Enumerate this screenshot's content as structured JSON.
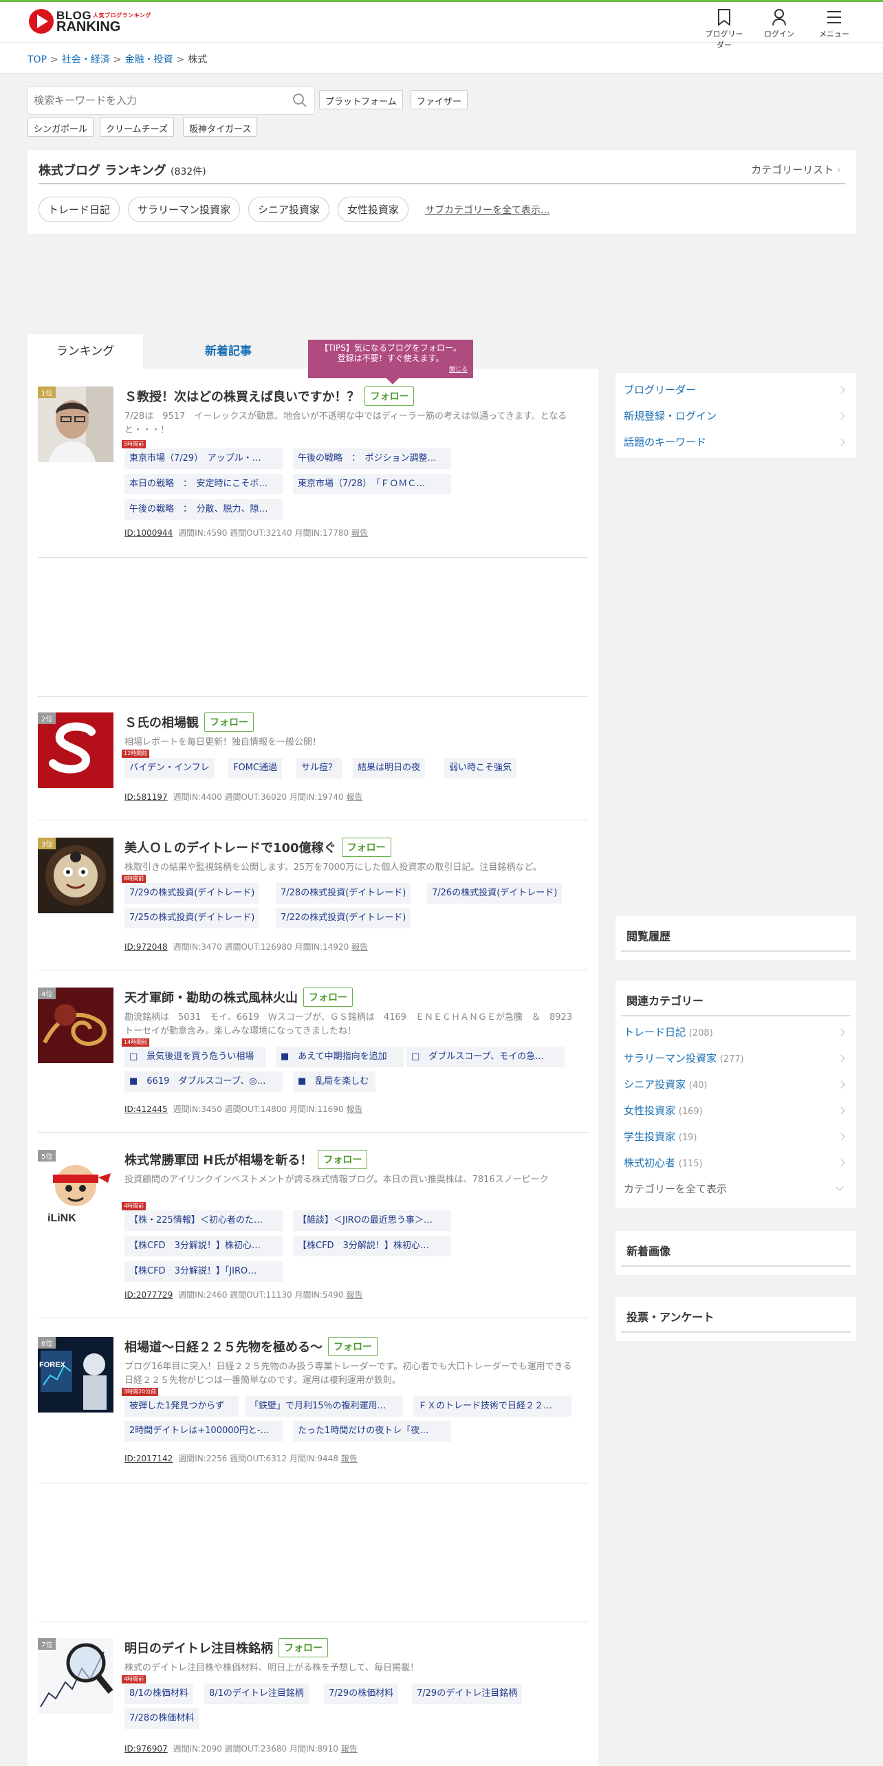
{
  "header": {
    "logo_line1": "BLOG",
    "logo_small": "人気ブログランキング",
    "logo_line2": "RANKING",
    "nav": [
      {
        "label": "ブログリーダー",
        "icon": "bookmark-icon"
      },
      {
        "label": "ログイン",
        "icon": "user-icon"
      },
      {
        "label": "メニュー",
        "icon": "hamburger-menu-icon"
      }
    ]
  },
  "breadcrumb": {
    "items": [
      "TOP",
      "社会・経済",
      "金融・投資"
    ],
    "separator": ">",
    "current": "株式"
  },
  "search": {
    "placeholder": "検索キーワードを入力",
    "keywords": [
      "プラットフォーム",
      "ファイザー",
      "シンガポール",
      "クリームチーズ",
      "阪神タイガース"
    ]
  },
  "ranking_header": {
    "title": "株式ブログ ランキング",
    "count": "(832件)",
    "category_list": "カテゴリーリスト",
    "subcategories": [
      "トレード日記",
      "サラリーマン投資家",
      "シニア投資家",
      "女性投資家"
    ],
    "more": "サブカテゴリーを全て表示..."
  },
  "tabs": {
    "ranking": "ランキング",
    "new_articles": "新着記事"
  },
  "tips": {
    "line1": "【TIPS】気になるブログをフォロー。",
    "line2": "登録は不要！すぐ使えます。",
    "close": "閉じる"
  },
  "follow_label": "フォロー",
  "report_label": "報告",
  "entries": [
    {
      "rank": "1位",
      "title": "Ｓ教授！次はどの株買えば良いですか！？",
      "desc": "7/28は　9517　イーレックスが動意。地合いが不透明な中ではディーラー筋の考えは似通ってきます。となると・・・！",
      "time": "5時間前",
      "tags": [
        "東京市場（7/29）　アップル・…",
        "午後の戦略　：　ポジション調整…",
        "本日の戦略　：　安定時にこそボ…",
        "東京市場（7/28）　「ＦＯＭＣ…",
        "午後の戦略　：　分散、脱力、隙…"
      ],
      "id": "ID:1000944",
      "stats": "週間IN:4590 週間OUT:32140 月間IN:17780"
    },
    {
      "rank": "2位",
      "title": "Ｓ氏の相場観",
      "desc": "相場レポートを毎日更新！独自情報を一般公開！",
      "time": "12時間前",
      "tags": [
        "バイデン・インフレ",
        "FOMC通過",
        "サル痘？",
        "結果は明日の夜",
        "弱い時こそ強気"
      ],
      "id": "ID:581197",
      "stats": "週間IN:4400 週間OUT:36020 月間IN:19740"
    },
    {
      "rank": "3位",
      "title": "美人ＯＬのデイトレードで100億稼ぐ",
      "desc": "株取引きの結果や監視銘柄を公開します。25万を7000万にした個人投資家の取引日記。注目銘柄など。",
      "time": "8時間前",
      "tags": [
        "7/29の株式投資(デイトレード)",
        "7/28の株式投資(デイトレード)",
        "7/26の株式投資(デイトレード)",
        "7/25の株式投資(デイトレード)",
        "7/22の株式投資(デイトレード)"
      ],
      "id": "ID:972048",
      "stats": "週間IN:3470 週間OUT:126980 月間IN:14920"
    },
    {
      "rank": "4位",
      "title": "天才軍師・勘助の株式風林火山",
      "desc": "勘流銘柄は　5031　モイ、6619　Ｗスコープが、ＧＳ銘柄は　4169　ＥＮＥＣＨＡＮＧＥが急騰　＆　8923　トーセイが動意含み。楽しみな環境になってきましたね！",
      "time": "14時間前",
      "tags": [
        "□　景気後退を買う危うい相場",
        "■　あえて中期指向を追加",
        "□　ダブルスコープ、モイの急…",
        "■　6619　ダブルスコープ、◎…",
        "■　乱局を楽しむ"
      ],
      "id": "ID:412445",
      "stats": "週間IN:3450 週間OUT:14800 月間IN:11690"
    },
    {
      "rank": "5位",
      "title": "株式常勝軍団 H氏が相場を斬る！",
      "desc": "投資顧問のアイリンクインベストメントが誇る株式情報ブログ。本日の買い推奨株は、7816スノーピーク",
      "time": "4時間前",
      "tags": [
        "【株・225情報】＜初心者のた…",
        "【雑談】＜JIROの最近思う事＞…",
        "【株CFD　3分解説！】株初心…",
        "【株CFD　3分解説！】株初心…",
        "【株CFD　3分解説！】「JIRO…"
      ],
      "id": "ID:2077729",
      "stats": "週間IN:2460 週間OUT:11130 月間IN:5490"
    },
    {
      "rank": "6位",
      "title": "相場道〜日経２２５先物を極める〜",
      "desc": "ブログ16年目に突入！日経２２５先物のみ扱う専業トレーダーです。初心者でも大口トレーダーでも運用できる日経２２５先物がじつは一番簡単なのです。運用は複利運用が鉄則。",
      "time": "3時間20分前",
      "tags": [
        "被弾した1発見つからず",
        "「鉄壁」で月利15％の複利運用…",
        "ＦＸのトレード技術で日経２２…",
        "2時間デイトレは+100000円と-…",
        "たった1時間だけの夜トレ「夜…"
      ],
      "id": "ID:2017142",
      "stats": "週間IN:2256 週間OUT:6312 月間IN:9448"
    },
    {
      "rank": "7位",
      "title": "明日のデイトレ注目株銘柄",
      "desc": "株式のデイトレ注目株や株価材料、明日上がる株を予想して、毎日掲載！",
      "time": "4時間前",
      "tags": [
        "8/1の株価材料",
        "8/1のデイトレ注目銘柄",
        "7/29の株価材料",
        "7/29のデイトレ注目銘柄",
        "7/28の株価材料"
      ],
      "id": "ID:976907",
      "stats": "週間IN:2090 週間OUT:23680 月間IN:8910"
    }
  ],
  "sidebar": {
    "links": [
      "ブログリーダー",
      "新規登録・ログイン",
      "話題のキーワード"
    ],
    "history_title": "閲覧履歴",
    "related_title": "関連カテゴリー",
    "related": [
      {
        "label": "トレード日記",
        "count": "(208)"
      },
      {
        "label": "サラリーマン投資家",
        "count": "(277)"
      },
      {
        "label": "シニア投資家",
        "count": "(40)"
      },
      {
        "label": "女性投資家",
        "count": "(169)"
      },
      {
        "label": "学生投資家",
        "count": "(19)"
      },
      {
        "label": "株式初心者",
        "count": "(115)"
      }
    ],
    "show_all": "カテゴリーを全て表示",
    "new_images_title": "新着画像",
    "poll_title": "投票・アンケート"
  }
}
